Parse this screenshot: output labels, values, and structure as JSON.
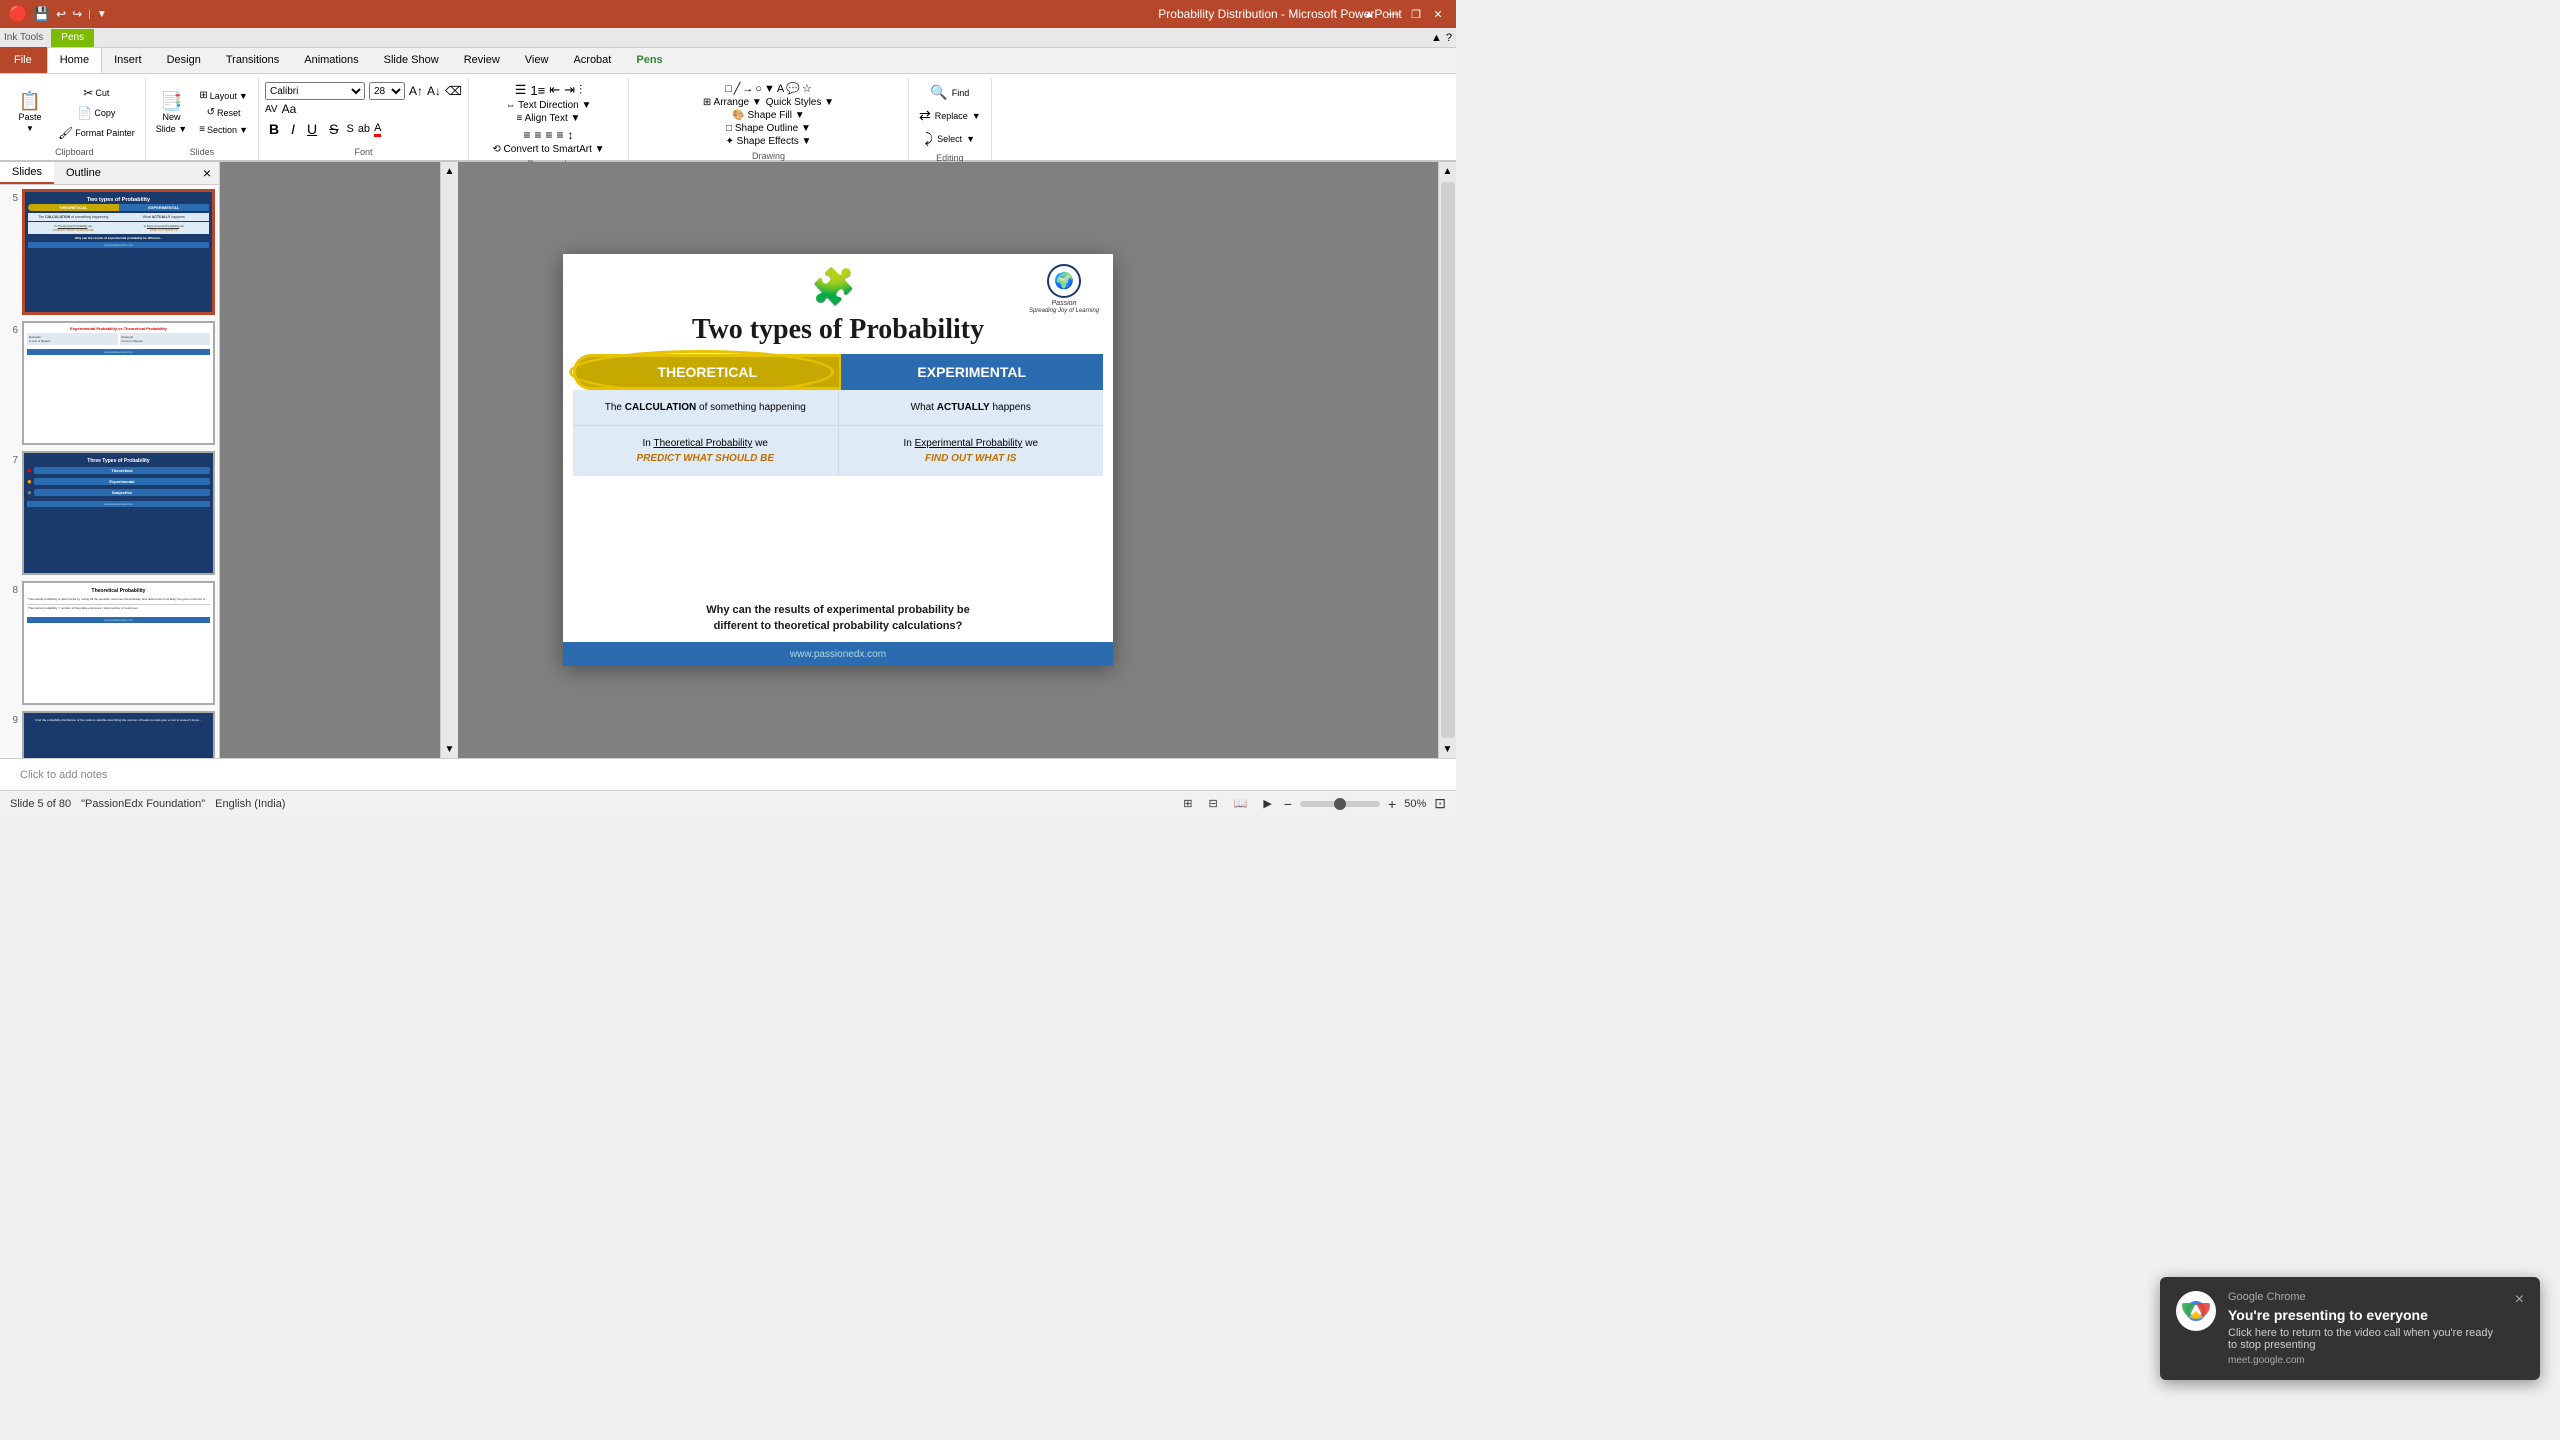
{
  "titlebar": {
    "title": "Probability Distribution - Microsoft PowerPoint",
    "min_label": "—",
    "max_label": "❐",
    "close_label": "✕"
  },
  "inktoolsbar": {
    "tab_label": "Ink Tools",
    "pens_label": "Pens",
    "quick_access": [
      "💾",
      "↩",
      "↪"
    ],
    "nav_arrows": [
      "◄",
      "►"
    ]
  },
  "ribbon_tabs": {
    "file": "File",
    "home": "Home",
    "insert": "Insert",
    "design": "Design",
    "transitions": "Transitions",
    "animations": "Animations",
    "slideshow": "Slide Show",
    "review": "Review",
    "view": "View",
    "acrobat": "Acrobat",
    "pens": "Pens"
  },
  "ribbon": {
    "clipboard": {
      "label": "Clipboard",
      "paste": "Paste",
      "cut": "Cut",
      "copy": "Copy",
      "format_painter": "Format Painter"
    },
    "slides": {
      "label": "Slides",
      "new_slide": "New\nSlide",
      "layout": "Layout",
      "reset": "Reset",
      "section": "Section"
    },
    "font": {
      "label": "Font",
      "bold": "B",
      "italic": "I",
      "underline": "U",
      "strikethrough": "S",
      "font_size": "28"
    },
    "paragraph": {
      "label": "Paragraph",
      "text_direction": "Text Direction",
      "align_text": "Align Text",
      "convert_smartart": "Convert to SmartArt"
    },
    "drawing": {
      "label": "Drawing",
      "arrange": "Arrange",
      "quick_styles": "Quick Styles",
      "shape_fill": "Shape Fill",
      "shape_outline": "Shape Outline",
      "shape_effects": "Shape Effects"
    },
    "editing": {
      "label": "Editing",
      "find": "Find",
      "replace": "Replace",
      "select": "Select"
    }
  },
  "panel": {
    "tabs": [
      "Slides",
      "Outline"
    ],
    "close": "×",
    "slides": [
      {
        "num": 5,
        "active": true
      },
      {
        "num": 6,
        "active": false
      },
      {
        "num": 7,
        "active": false
      },
      {
        "num": 8,
        "active": false
      },
      {
        "num": 9,
        "active": false
      }
    ]
  },
  "slide": {
    "title": "Two types of Probability",
    "theoretical_label": "THEORETICAL",
    "experimental_label": "EXPERIMENTAL",
    "cell1_line1": "The ",
    "cell1_bold": "CALCULATION",
    "cell1_line2": " of something happening",
    "cell2_line1": "What ",
    "cell2_bold": "ACTUALLY",
    "cell2_line2": " happens",
    "cell3_pre": "In ",
    "cell3_link": "Theoretical Probability",
    "cell3_post": " we",
    "cell3_orange": "PREDICT WHAT SHOULD BE",
    "cell4_pre": "In ",
    "cell4_link": "Experimental Probability",
    "cell4_post": " we",
    "cell4_orange": "FIND OUT WHAT IS",
    "question": "Why can the results of experimental probability be\ndifferent to theoretical probability calculations?",
    "url": "www.passionedx.com",
    "logo_text": "Passion",
    "logo_sub": "Spreading Joy of Learning"
  },
  "notes": {
    "placeholder": "Click to add notes"
  },
  "statusbar": {
    "slide_info": "Slide 5 of 80",
    "theme": "\"PassionEdx Foundation\"",
    "language": "English (India)",
    "zoom": "50%",
    "zoom_minus": "−",
    "zoom_plus": "+"
  },
  "notification": {
    "app": "Google Chrome",
    "heading": "You're presenting to everyone",
    "text": "Click here to return to the video call\nwhen you're ready to stop presenting",
    "url": "meet.google.com",
    "close": "×"
  },
  "thumbnails": {
    "slide5": {
      "title": "Two types of Probability",
      "theoretical": "THEORETICAL",
      "experimental": "EXPERIMENTAL"
    },
    "slide6": {
      "title": "Experimental Probability vs Theoretical Probability"
    },
    "slide7": {
      "title": "Three Types of Probability",
      "items": [
        "Theoretical",
        "Experimental",
        "Subjective"
      ]
    },
    "slide8": {
      "title": "Theoretical Probability"
    },
    "slide9": {
      "title": "..."
    }
  }
}
